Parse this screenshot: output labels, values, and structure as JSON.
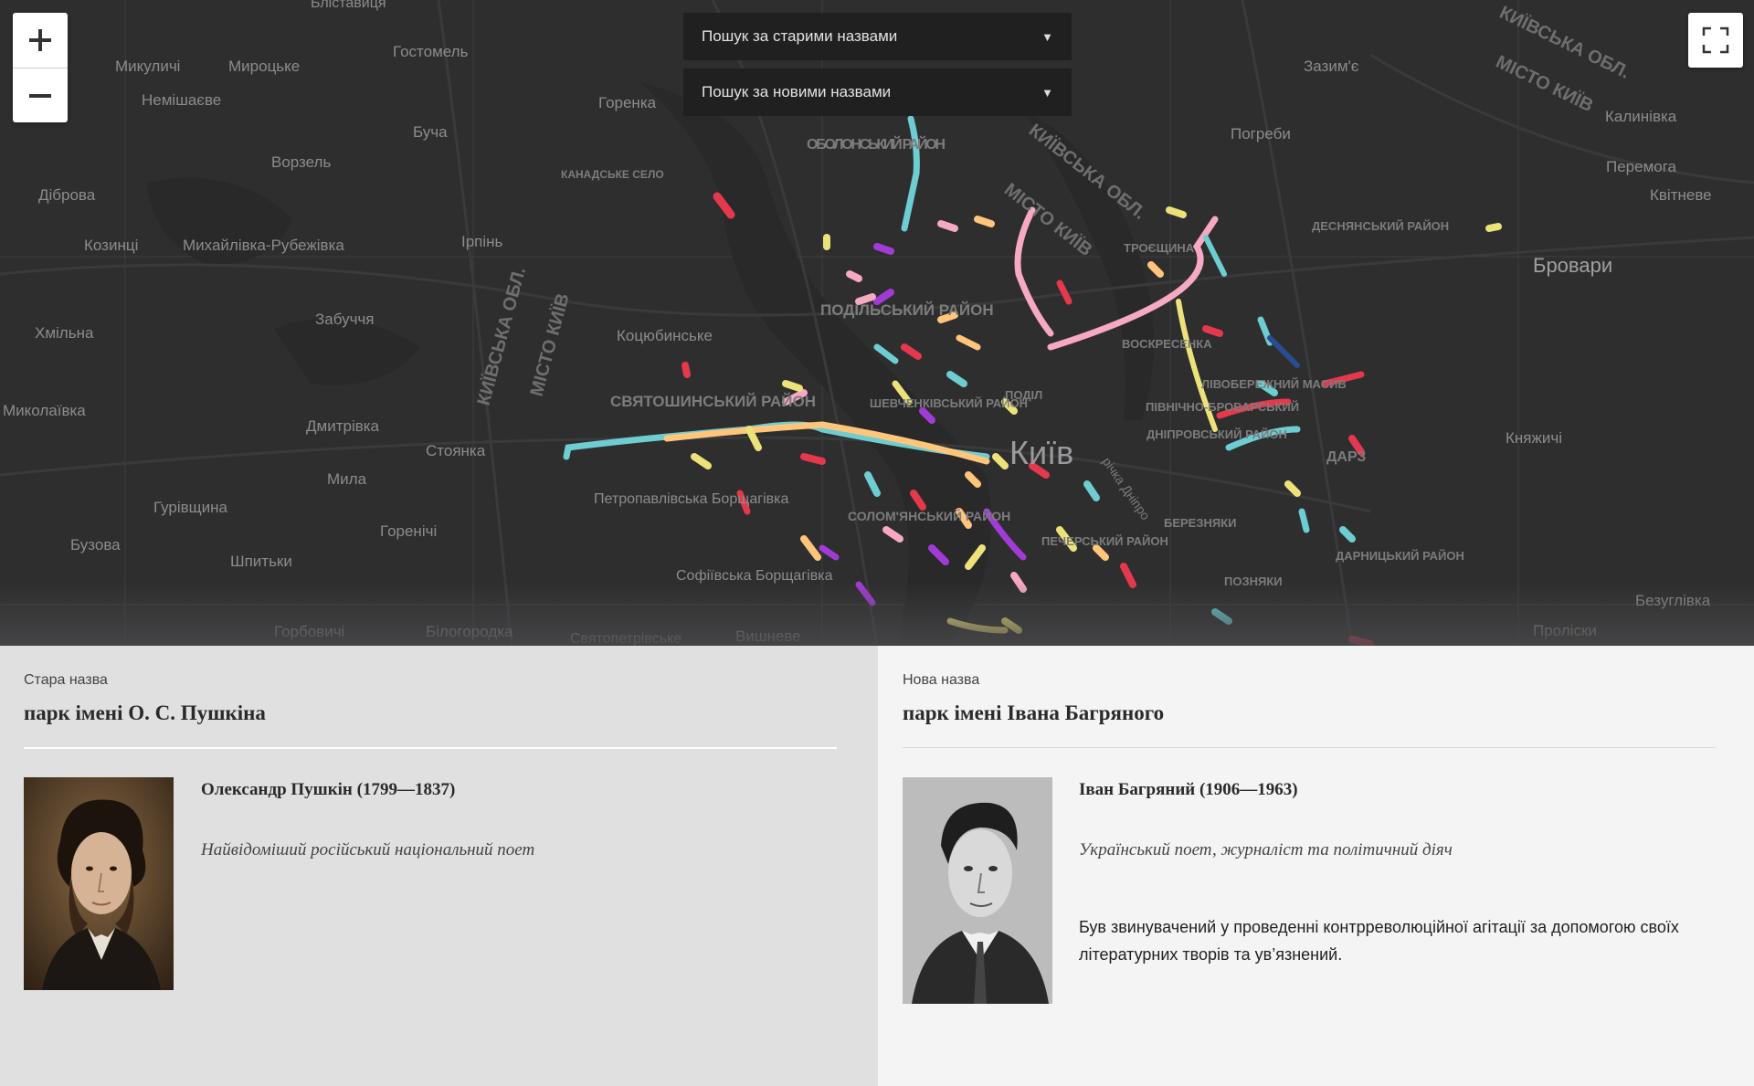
{
  "map": {
    "search_old": "Пошук за старими назвами",
    "search_new": "Пошук за новими назвами",
    "zoom_in": "+",
    "zoom_out": "−",
    "city_label": "Київ",
    "background_color": "#2e2e2f",
    "places": [
      {
        "name": "Бліставиця",
        "kind": "town"
      },
      {
        "name": "Гостомель",
        "kind": "town"
      },
      {
        "name": "Микуличі",
        "kind": "town"
      },
      {
        "name": "Мироцьке",
        "kind": "town"
      },
      {
        "name": "Немішаєве",
        "kind": "town"
      },
      {
        "name": "Буча",
        "kind": "town"
      },
      {
        "name": "Горенка",
        "kind": "town"
      },
      {
        "name": "Ворзель",
        "kind": "town"
      },
      {
        "name": "Діброва",
        "kind": "town"
      },
      {
        "name": "Козинці",
        "kind": "town"
      },
      {
        "name": "Михайлівка-Рубежівка",
        "kind": "town"
      },
      {
        "name": "Ірпінь",
        "kind": "town"
      },
      {
        "name": "Хмільна",
        "kind": "town"
      },
      {
        "name": "Забуччя",
        "kind": "town"
      },
      {
        "name": "Коцюбинське",
        "kind": "town"
      },
      {
        "name": "Миколаївка",
        "kind": "town"
      },
      {
        "name": "Дмитрівка",
        "kind": "town"
      },
      {
        "name": "Стоянка",
        "kind": "town"
      },
      {
        "name": "Мила",
        "kind": "town"
      },
      {
        "name": "Гурівщина",
        "kind": "town"
      },
      {
        "name": "Горенічі",
        "kind": "town"
      },
      {
        "name": "Бузова",
        "kind": "town"
      },
      {
        "name": "Шпитьки",
        "kind": "town"
      },
      {
        "name": "Петропавлівська Борщагівка",
        "kind": "town"
      },
      {
        "name": "Софіївська Борщагівка",
        "kind": "town"
      },
      {
        "name": "Горбовичі",
        "kind": "town"
      },
      {
        "name": "Білогородка",
        "kind": "town"
      },
      {
        "name": "Святопетрівське",
        "kind": "town"
      },
      {
        "name": "Вишневе",
        "kind": "town"
      },
      {
        "name": "Зазим'є",
        "kind": "town"
      },
      {
        "name": "Погреби",
        "kind": "town"
      },
      {
        "name": "Калинівка",
        "kind": "town"
      },
      {
        "name": "Перемога",
        "kind": "town"
      },
      {
        "name": "Квітневе",
        "kind": "town"
      },
      {
        "name": "Бровари",
        "kind": "city"
      },
      {
        "name": "Княжичі",
        "kind": "town"
      },
      {
        "name": "Безуглівка",
        "kind": "town"
      },
      {
        "name": "Проліски",
        "kind": "town"
      },
      {
        "name": "ОБОЛОНСЬКИЙ РАЙОН",
        "kind": "district"
      },
      {
        "name": "КАНАДСЬКЕ СЕЛО",
        "kind": "district"
      },
      {
        "name": "ПОДІЛЬСЬКИЙ РАЙОН",
        "kind": "district"
      },
      {
        "name": "СВЯТОШИНСЬКИЙ РАЙОН",
        "kind": "district"
      },
      {
        "name": "ШЕВЧЕНКІВСЬКИЙ РАЙОН",
        "kind": "district"
      },
      {
        "name": "СОЛОМ'ЯНСЬКИЙ РАЙОН",
        "kind": "district"
      },
      {
        "name": "ДЕСНЯНСЬКИЙ РАЙОН",
        "kind": "district"
      },
      {
        "name": "ДНІПРОВСЬКИЙ РАЙОН",
        "kind": "district"
      },
      {
        "name": "ДАРНИЦЬКИЙ РАЙОН",
        "kind": "district"
      },
      {
        "name": "ПЕЧЕРСЬКИЙ РАЙОН",
        "kind": "district"
      },
      {
        "name": "ВОСКРЕСЕНКА",
        "kind": "district"
      },
      {
        "name": "ЛІВОБЕРЕЖНИЙ МАСИВ",
        "kind": "district"
      },
      {
        "name": "ПІВНІЧНО-БРОВАРСЬКИЙ",
        "kind": "district"
      },
      {
        "name": "БЕРЕЗНЯКИ",
        "kind": "district"
      },
      {
        "name": "ПОЗНЯКИ",
        "kind": "district"
      },
      {
        "name": "ТРОЄЩИНА",
        "kind": "district"
      },
      {
        "name": "ПОДІЛ",
        "kind": "district"
      },
      {
        "name": "ДАРЗ",
        "kind": "district"
      },
      {
        "name": "КИЇВСЬКА ОБЛ.",
        "kind": "region"
      },
      {
        "name": "МІСТО КИЇВ",
        "kind": "region"
      },
      {
        "name": "річка Дніпро",
        "kind": "river"
      }
    ]
  },
  "left": {
    "label": "Стара назва",
    "name": "парк імені О. С. Пушкіна",
    "person": "Олександр Пушкін (1799—1837)",
    "description": "Найвідоміший російський національний поет"
  },
  "right": {
    "label": "Нова назва",
    "name": "парк імені Івана Багряного",
    "person": "Іван Багряний (1906—1963)",
    "description": "Український поет, журналіст та політичний діяч",
    "bio": "Був звинувачений у проведенні контрреволюційної агітації за допомогою своїх літературних творів та ув’язнений."
  }
}
